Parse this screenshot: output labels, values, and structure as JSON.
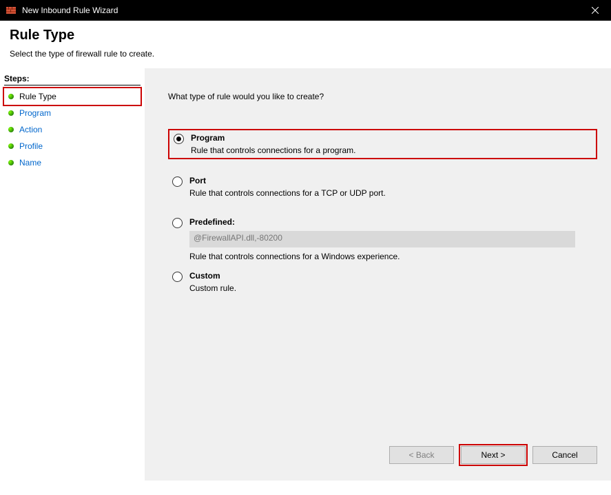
{
  "window": {
    "title": "New Inbound Rule Wizard"
  },
  "header": {
    "title": "Rule Type",
    "subtitle": "Select the type of firewall rule to create."
  },
  "sidebar": {
    "label": "Steps:",
    "items": [
      {
        "label": "Rule Type",
        "active": true
      },
      {
        "label": "Program"
      },
      {
        "label": "Action"
      },
      {
        "label": "Profile"
      },
      {
        "label": "Name"
      }
    ]
  },
  "main": {
    "question": "What type of rule would you like to create?",
    "options": {
      "program": {
        "title": "Program",
        "desc": "Rule that controls connections for a program."
      },
      "port": {
        "title": "Port",
        "desc": "Rule that controls connections for a TCP or UDP port."
      },
      "predefined": {
        "title": "Predefined:",
        "value": "@FirewallAPI.dll,-80200",
        "desc": "Rule that controls connections for a Windows experience."
      },
      "custom": {
        "title": "Custom",
        "desc": "Custom rule."
      }
    }
  },
  "buttons": {
    "back": "< Back",
    "next": "Next >",
    "cancel": "Cancel"
  }
}
